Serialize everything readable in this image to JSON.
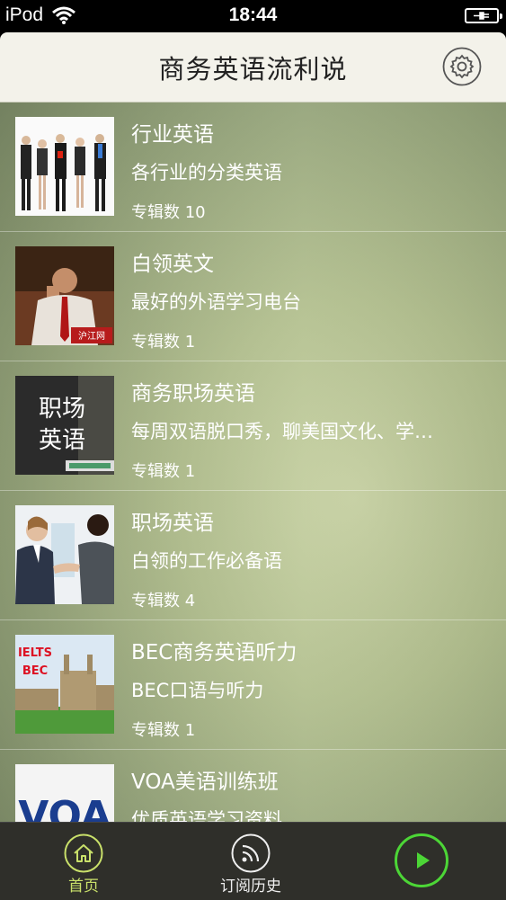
{
  "status": {
    "device": "iPod",
    "time": "18:44"
  },
  "header": {
    "title": "商务英语流利说"
  },
  "items": [
    {
      "title": "行业英语",
      "subtitle": "各行业的分类英语",
      "count": "专辑数 10"
    },
    {
      "title": "白领英文",
      "subtitle": "最好的外语学习电台",
      "count": "专辑数 1",
      "thumb_logo": "沪江网"
    },
    {
      "title": "商务职场英语",
      "subtitle": "每周双语脱口秀，聊美国文化、学…",
      "count": "专辑数 1",
      "thumb_text": [
        "职场",
        "英语"
      ]
    },
    {
      "title": "职场英语",
      "subtitle": "白领的工作必备语",
      "count": "专辑数 4"
    },
    {
      "title": "BEC商务英语听力",
      "subtitle": "BEC口语与听力",
      "count": "专辑数 1",
      "thumb_text": [
        "IELTS",
        "BEC"
      ]
    },
    {
      "title": "VOA美语训练班",
      "subtitle": "优质英语学习资料",
      "count": "",
      "thumb_text": [
        "VOA"
      ]
    }
  ],
  "tabs": {
    "home": "首页",
    "history": "订阅历史"
  },
  "colors": {
    "accent": "#4cd636",
    "header_bg": "#f3f2ea",
    "tabbar_bg": "#2f2f2a",
    "home_active": "#c9e06a"
  },
  "icons": [
    "wifi-icon",
    "battery-icon",
    "gear-icon",
    "home-icon",
    "rss-icon",
    "play-icon"
  ]
}
